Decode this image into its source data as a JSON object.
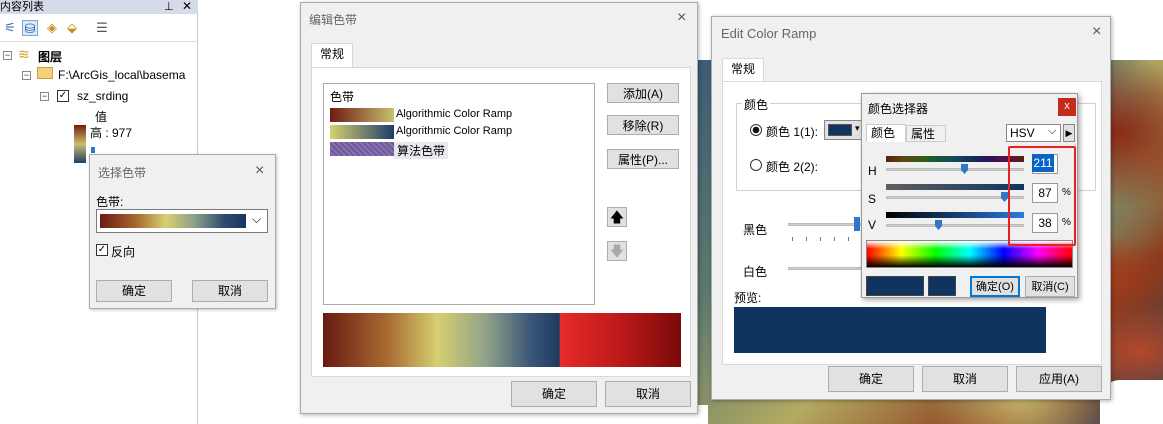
{
  "toc": {
    "title": "内容列表",
    "layers_label": "图层",
    "folder_path": "F:\\ArcGis_local\\basema",
    "layer_name": "sz_srding",
    "value_label": "值",
    "high_label": "高 : 977"
  },
  "select_ramp": {
    "title": "选择色带",
    "ramp_label": "色带:",
    "reverse_label": "反向",
    "ok": "确定",
    "cancel": "取消"
  },
  "edit_ramp_cn": {
    "title": "编辑色带",
    "tab": "常规",
    "list_header": "色带",
    "items": [
      {
        "label": "Algorithmic Color Ramp"
      },
      {
        "label": "Algorithmic Color Ramp"
      },
      {
        "label": "算法色带"
      }
    ],
    "add": "添加(A)",
    "remove": "移除(R)",
    "properties": "属性(P)...",
    "ok": "确定",
    "cancel": "取消"
  },
  "edit_ramp_en": {
    "title": "Edit Color Ramp",
    "tab": "常规",
    "color_group": "颜色",
    "color1": "颜色 1(1):",
    "color2": "颜色 2(2):",
    "black": "黑色",
    "white": "白色",
    "preview": "预览:",
    "ok": "确定",
    "cancel": "取消",
    "apply": "应用(A)"
  },
  "color_picker": {
    "title": "颜色选择器",
    "close": "x",
    "tab_color": "颜色",
    "tab_props": "属性",
    "model": "HSV",
    "h_label": "H",
    "s_label": "S",
    "v_label": "V",
    "h_value": "211",
    "s_value": "87",
    "v_value": "38",
    "pct": "%",
    "ok": "确定(O)",
    "cancel": "取消(C)"
  },
  "colors": {
    "selected_color": "#0f3460",
    "highlight": "#e82020",
    "accent": "#0078d7"
  }
}
